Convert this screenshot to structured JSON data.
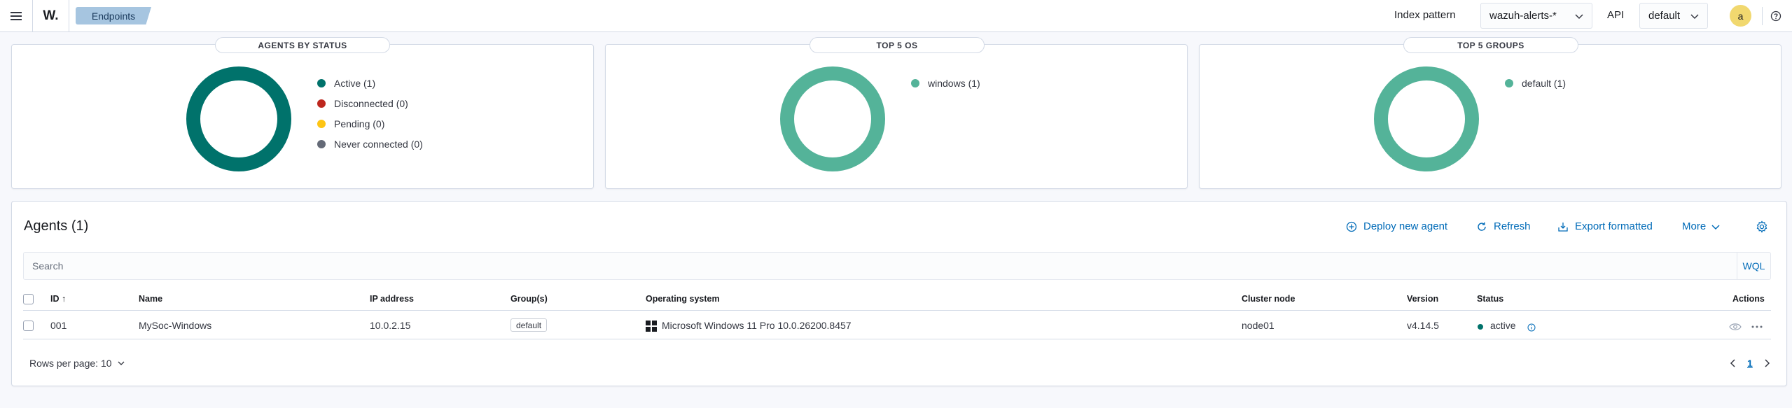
{
  "header": {
    "breadcrumb": "Endpoints",
    "logo": "W.",
    "index_pattern_label": "Index pattern",
    "index_pattern_value": "wazuh-alerts-*",
    "api_label": "API",
    "api_value": "default",
    "avatar_letter": "a"
  },
  "panels": [
    {
      "title": "AGENTS BY STATUS",
      "donut_color": "#00726b",
      "legend": [
        {
          "label": "Active (1)",
          "color": "#00726b"
        },
        {
          "label": "Disconnected (0)",
          "color": "#bd271e"
        },
        {
          "label": "Pending (0)",
          "color": "#fec514"
        },
        {
          "label": "Never connected (0)",
          "color": "#646a77"
        }
      ]
    },
    {
      "title": "TOP 5 OS",
      "donut_color": "#54b399",
      "legend": [
        {
          "label": "windows (1)",
          "color": "#54b399"
        }
      ]
    },
    {
      "title": "TOP 5 GROUPS",
      "donut_color": "#54b399",
      "legend": [
        {
          "label": "default (1)",
          "color": "#54b399"
        }
      ]
    }
  ],
  "agents": {
    "title": "Agents (1)",
    "actions": {
      "deploy": "Deploy new agent",
      "refresh": "Refresh",
      "export": "Export formatted",
      "more": "More"
    },
    "search_placeholder": "Search",
    "wql": "WQL",
    "columns": {
      "id": "ID",
      "name": "Name",
      "ip": "IP address",
      "groups": "Group(s)",
      "os": "Operating system",
      "cluster": "Cluster node",
      "version": "Version",
      "status": "Status",
      "actions": "Actions"
    },
    "rows": [
      {
        "id": "001",
        "name": "MySoc-Windows",
        "ip": "10.0.2.15",
        "group": "default",
        "os": "Microsoft Windows 11 Pro 10.0.26200.8457",
        "cluster": "node01",
        "version": "v4.14.5",
        "status": "active"
      }
    ],
    "rows_per_page": "Rows per page: 10",
    "current_page": "1"
  }
}
